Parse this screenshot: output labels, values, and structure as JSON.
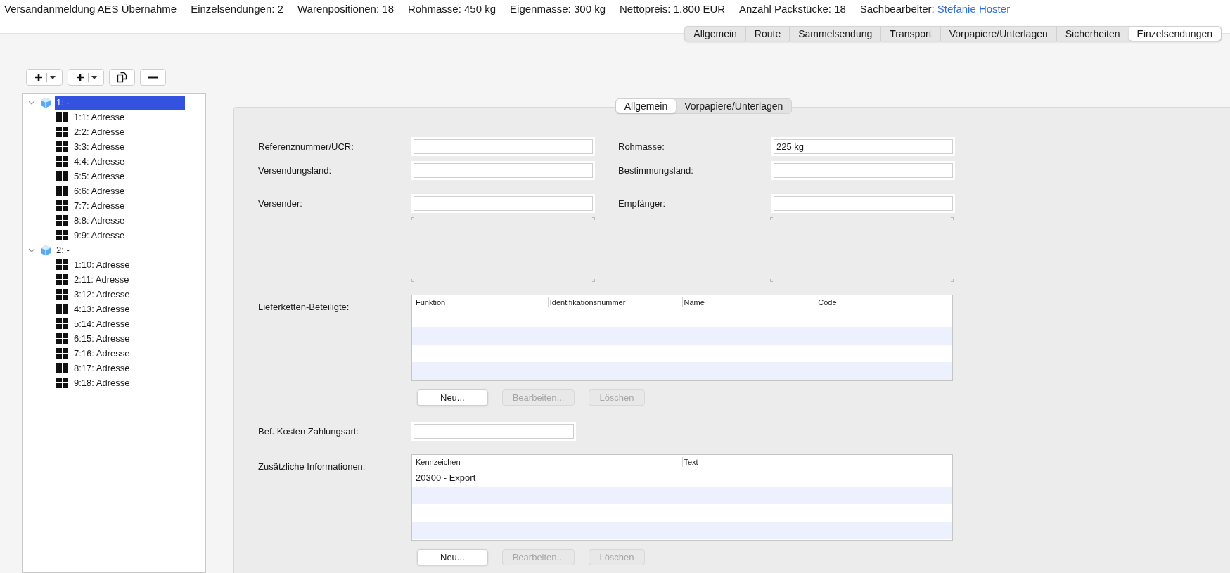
{
  "header": {
    "title": "Versandanmeldung AES Übernahme",
    "summary": [
      {
        "label": "Einzelsendungen:",
        "value": "2"
      },
      {
        "label": "Warenpositionen:",
        "value": "18"
      },
      {
        "label": "Rohmasse:",
        "value": "450 kg"
      },
      {
        "label": "Eigenmasse:",
        "value": "300 kg"
      },
      {
        "label": "Nettopreis:",
        "value": "1.800 EUR"
      },
      {
        "label": "Anzahl Packstücke:",
        "value": "18"
      }
    ],
    "clerk": {
      "label": "Sachbearbeiter:",
      "value": "Stefanie Hoster"
    }
  },
  "tabs": [
    {
      "label": "Allgemein",
      "selected": false
    },
    {
      "label": "Route",
      "selected": false
    },
    {
      "label": "Sammelsendung",
      "selected": false
    },
    {
      "label": "Transport",
      "selected": false
    },
    {
      "label": "Vorpapiere/Unterlagen",
      "selected": false
    },
    {
      "label": "Sicherheiten",
      "selected": false
    },
    {
      "label": "Einzelsendungen",
      "selected": true
    }
  ],
  "toolbar": [
    {
      "kind": "add-menu"
    },
    {
      "kind": "add-menu"
    },
    {
      "kind": "copy"
    },
    {
      "kind": "remove"
    }
  ],
  "tree": [
    {
      "label": "1: -",
      "expanded": true,
      "selected": true,
      "children": [
        {
          "label": "1:1: Adresse",
          "selected": false
        },
        {
          "label": "2:2: Adresse",
          "selected": false
        },
        {
          "label": "3:3: Adresse",
          "selected": false
        },
        {
          "label": "4:4: Adresse",
          "selected": false
        },
        {
          "label": "5:5: Adresse",
          "selected": false
        },
        {
          "label": "6:6: Adresse",
          "selected": false
        },
        {
          "label": "7:7: Adresse",
          "selected": false
        },
        {
          "label": "8:8: Adresse",
          "selected": false
        },
        {
          "label": "9:9: Adresse",
          "selected": false
        }
      ]
    },
    {
      "label": "2: -",
      "expanded": true,
      "selected": false,
      "children": [
        {
          "label": "1:10: Adresse",
          "selected": false
        },
        {
          "label": "2:11: Adresse",
          "selected": false
        },
        {
          "label": "3:12: Adresse",
          "selected": false
        },
        {
          "label": "4:13: Adresse",
          "selected": false
        },
        {
          "label": "5:14: Adresse",
          "selected": false
        },
        {
          "label": "6:15: Adresse",
          "selected": false
        },
        {
          "label": "7:16: Adresse",
          "selected": false
        },
        {
          "label": "8:17: Adresse",
          "selected": false
        },
        {
          "label": "9:18: Adresse",
          "selected": false
        }
      ]
    }
  ],
  "subtabs": [
    {
      "label": "Allgemein",
      "selected": true
    },
    {
      "label": "Vorpapiere/Unterlagen",
      "selected": false
    }
  ],
  "form": {
    "rows": [
      [
        {
          "label": "Referenznummer/UCR:"
        },
        {
          "label": "Rohmasse:",
          "value": "225 kg"
        }
      ],
      [
        {
          "label": "Versendungsland:"
        },
        {
          "label": "Bestimmungsland:"
        }
      ],
      [
        {
          "label": "Versender:"
        },
        {
          "label": "Empfänger:"
        }
      ]
    ],
    "supply_chain": {
      "label": "Lieferketten-Beteiligte:",
      "columns": [
        "Funktion",
        "Identifikationsnummer",
        "Name",
        "Code"
      ],
      "buttons": [
        {
          "label": "Neu...",
          "disabled": false
        },
        {
          "label": "Bearbeiten...",
          "disabled": true
        },
        {
          "label": "Löschen",
          "disabled": true
        }
      ]
    },
    "payment": {
      "label": "Bef. Kosten Zahlungsart:"
    },
    "additional": {
      "label": "Zusätzliche Informationen:",
      "columns": [
        "Kennzeichen",
        "Text"
      ],
      "rows": [
        [
          "20300 - Export"
        ]
      ],
      "buttons": [
        {
          "label": "Neu...",
          "disabled": false
        },
        {
          "label": "Bearbeiten...",
          "disabled": true
        },
        {
          "label": "Löschen",
          "disabled": true
        }
      ]
    }
  }
}
